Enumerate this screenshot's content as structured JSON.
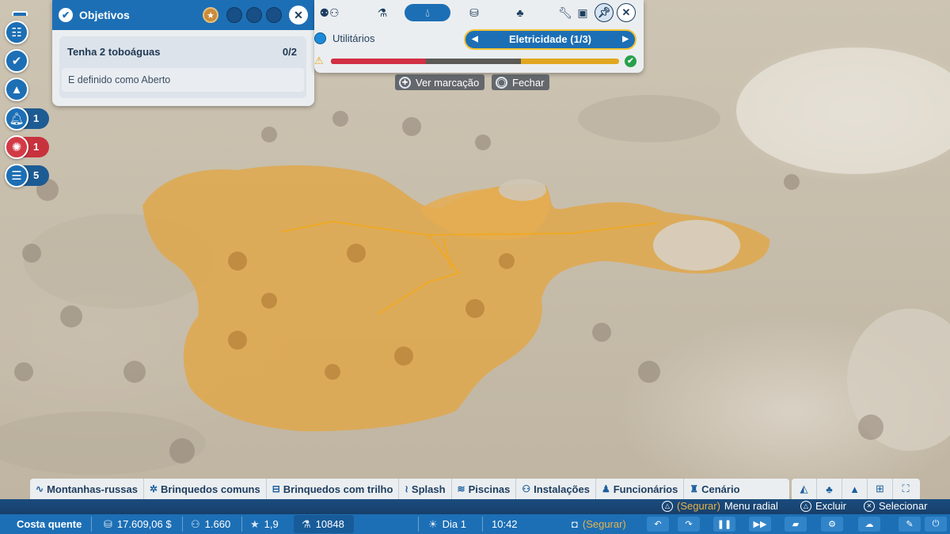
{
  "objectives": {
    "title": "Objetivos",
    "task": "Tenha 2 toboáguas",
    "progress": "0/2",
    "condition": "E definido como Aberto"
  },
  "left_column": {
    "bell_count": "1",
    "alert_count": "1",
    "list_count": "5"
  },
  "utilities": {
    "label": "Utilitários",
    "selector": "Eletricidade (1/3)",
    "bar": {
      "red_fraction": 0.33,
      "dark_fraction": 0.33,
      "yellow_fraction": 0.34
    }
  },
  "hints": {
    "view_marking": "Ver marcação",
    "close": "Fechar"
  },
  "categories": [
    {
      "icon": "coaster-icon",
      "label": "Montanhas-russas"
    },
    {
      "icon": "ride-icon",
      "label": "Brinquedos comuns"
    },
    {
      "icon": "track-ride-icon",
      "label": "Brinquedos com trilho"
    },
    {
      "icon": "splash-icon",
      "label": "Splash"
    },
    {
      "icon": "pool-icon",
      "label": "Piscinas"
    },
    {
      "icon": "facilities-icon",
      "label": "Instalações"
    },
    {
      "icon": "staff-icon",
      "label": "Funcionários"
    },
    {
      "icon": "scenery-icon",
      "label": "Cenário"
    }
  ],
  "hint_strip": {
    "hold": "(Segurar)",
    "radial_menu": "Menu radial",
    "delete": "Excluir",
    "select": "Selecionar"
  },
  "status": {
    "park_name": "Costa quente",
    "money": "17.609,06 $",
    "guests": "1.660",
    "rating": "1,9",
    "research": "10848",
    "day": "Dia 1",
    "time": "10:42",
    "hold": "(Segurar)"
  },
  "colors": {
    "accent": "#1d6fb5",
    "highlight": "#f2c233",
    "danger": "#d12f44",
    "success": "#27a04b",
    "selection": "#e1a748"
  }
}
